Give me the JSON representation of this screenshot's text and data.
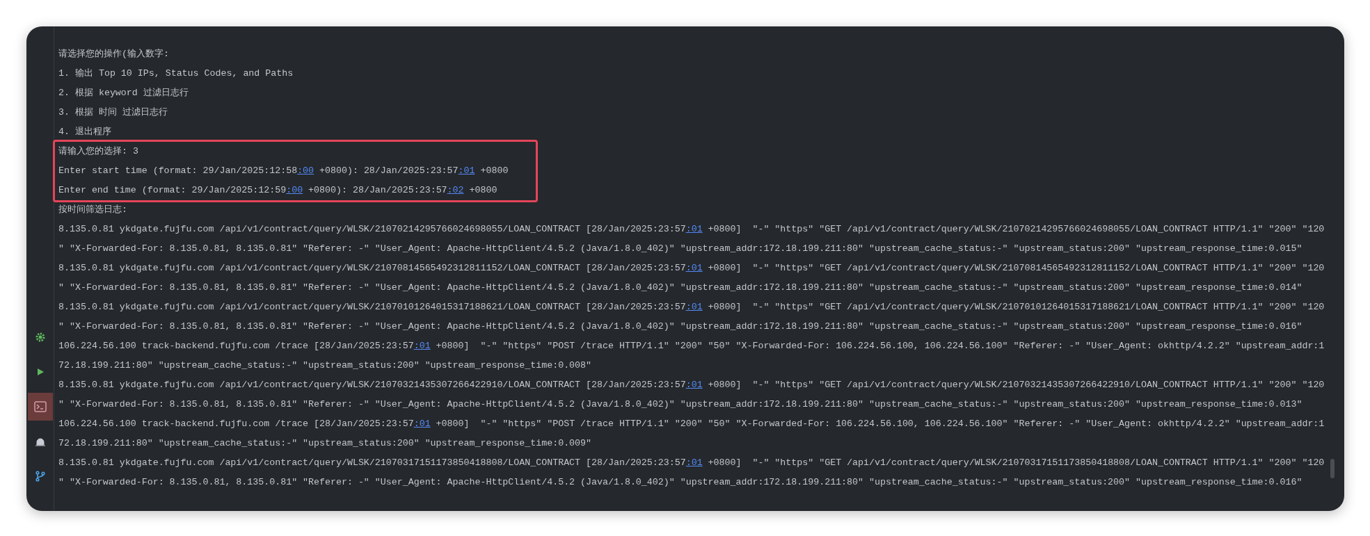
{
  "tool_strip": [
    {
      "selected": false
    },
    {
      "selected": false
    },
    {
      "selected": true
    },
    {
      "selected": false
    },
    {
      "selected": false
    }
  ],
  "console_lines": [
    {
      "highlighted": false,
      "segments": [
        {
          "kind": "plain",
          "text": "请选择您的操作(输入数字:"
        }
      ]
    },
    {
      "highlighted": false,
      "segments": [
        {
          "kind": "plain",
          "text": "1. 输出 Top 10 IPs, Status Codes, and Paths"
        }
      ]
    },
    {
      "highlighted": false,
      "segments": [
        {
          "kind": "plain",
          "text": "2. 根据 keyword 过滤日志行"
        }
      ]
    },
    {
      "highlighted": false,
      "segments": [
        {
          "kind": "plain",
          "text": "3. 根据 时间 过滤日志行"
        }
      ]
    },
    {
      "highlighted": false,
      "segments": [
        {
          "kind": "plain",
          "text": "4. 退出程序"
        }
      ]
    },
    {
      "highlighted": true,
      "segments": [
        {
          "kind": "plain",
          "text": "请输入您的选择: 3"
        }
      ]
    },
    {
      "highlighted": true,
      "segments": [
        {
          "kind": "plain",
          "text": "Enter start time (format: 29/Jan/2025:12:58"
        },
        {
          "kind": "link",
          "text": ":00"
        },
        {
          "kind": "plain",
          "text": " +0800): 28/Jan/2025:23:57"
        },
        {
          "kind": "link",
          "text": ":01"
        },
        {
          "kind": "plain",
          "text": " +0800"
        }
      ]
    },
    {
      "highlighted": true,
      "segments": [
        {
          "kind": "plain",
          "text": "Enter end time (format: 29/Jan/2025:12:59"
        },
        {
          "kind": "link",
          "text": ":00"
        },
        {
          "kind": "plain",
          "text": " +0800): 28/Jan/2025:23:57"
        },
        {
          "kind": "link",
          "text": ":02"
        },
        {
          "kind": "plain",
          "text": " +0800"
        }
      ]
    },
    {
      "highlighted": false,
      "segments": [
        {
          "kind": "plain",
          "text": "按时间筛选日志:"
        }
      ]
    },
    {
      "highlighted": false,
      "segments": [
        {
          "kind": "plain",
          "text": "8.135.0.81 ykdgate.fujfu.com /api/v1/contract/query/WLSK/21070214295766024698055/LOAN_CONTRACT [28/Jan/2025:23:57"
        },
        {
          "kind": "link",
          "text": ":01"
        },
        {
          "kind": "plain",
          "text": " +0800]  \"-\" \"https\" \"GET /api/v1/contract/query/WLSK/21070214295766024698055/LOAN_CONTRACT HTTP/1.1\" \"200\" \"120"
        }
      ]
    },
    {
      "highlighted": false,
      "segments": [
        {
          "kind": "plain",
          "text": "\" \"X-Forwarded-For: 8.135.0.81, 8.135.0.81\" \"Referer: -\" \"User_Agent: Apache-HttpClient/4.5.2 (Java/1.8.0_402)\" \"upstream_addr:172.18.199.211:80\" \"upstream_cache_status:-\" \"upstream_status:200\" \"upstream_response_time:0.015\""
        }
      ]
    },
    {
      "highlighted": false,
      "segments": [
        {
          "kind": "plain",
          "text": "8.135.0.81 ykdgate.fujfu.com /api/v1/contract/query/WLSK/21070814565492312811152/LOAN_CONTRACT [28/Jan/2025:23:57"
        },
        {
          "kind": "link",
          "text": ":01"
        },
        {
          "kind": "plain",
          "text": " +0800]  \"-\" \"https\" \"GET /api/v1/contract/query/WLSK/21070814565492312811152/LOAN_CONTRACT HTTP/1.1\" \"200\" \"120"
        }
      ]
    },
    {
      "highlighted": false,
      "segments": [
        {
          "kind": "plain",
          "text": "\" \"X-Forwarded-For: 8.135.0.81, 8.135.0.81\" \"Referer: -\" \"User_Agent: Apache-HttpClient/4.5.2 (Java/1.8.0_402)\" \"upstream_addr:172.18.199.211:80\" \"upstream_cache_status:-\" \"upstream_status:200\" \"upstream_response_time:0.014\""
        }
      ]
    },
    {
      "highlighted": false,
      "segments": [
        {
          "kind": "plain",
          "text": "8.135.0.81 ykdgate.fujfu.com /api/v1/contract/query/WLSK/21070101264015317188621/LOAN_CONTRACT [28/Jan/2025:23:57"
        },
        {
          "kind": "link",
          "text": ":01"
        },
        {
          "kind": "plain",
          "text": " +0800]  \"-\" \"https\" \"GET /api/v1/contract/query/WLSK/21070101264015317188621/LOAN_CONTRACT HTTP/1.1\" \"200\" \"120"
        }
      ]
    },
    {
      "highlighted": false,
      "segments": [
        {
          "kind": "plain",
          "text": "\" \"X-Forwarded-For: 8.135.0.81, 8.135.0.81\" \"Referer: -\" \"User_Agent: Apache-HttpClient/4.5.2 (Java/1.8.0_402)\" \"upstream_addr:172.18.199.211:80\" \"upstream_cache_status:-\" \"upstream_status:200\" \"upstream_response_time:0.016\""
        }
      ]
    },
    {
      "highlighted": false,
      "segments": [
        {
          "kind": "plain",
          "text": "106.224.56.100 track-backend.fujfu.com /trace [28/Jan/2025:23:57"
        },
        {
          "kind": "link",
          "text": ":01"
        },
        {
          "kind": "plain",
          "text": " +0800]  \"-\" \"https\" \"POST /trace HTTP/1.1\" \"200\" \"50\" \"X-Forwarded-For: 106.224.56.100, 106.224.56.100\" \"Referer: -\" \"User_Agent: okhttp/4.2.2\" \"upstream_addr:1"
        }
      ]
    },
    {
      "highlighted": false,
      "segments": [
        {
          "kind": "plain",
          "text": "72.18.199.211:80\" \"upstream_cache_status:-\" \"upstream_status:200\" \"upstream_response_time:0.008\""
        }
      ]
    },
    {
      "highlighted": false,
      "segments": [
        {
          "kind": "plain",
          "text": "8.135.0.81 ykdgate.fujfu.com /api/v1/contract/query/WLSK/21070321435307266422910/LOAN_CONTRACT [28/Jan/2025:23:57"
        },
        {
          "kind": "link",
          "text": ":01"
        },
        {
          "kind": "plain",
          "text": " +0800]  \"-\" \"https\" \"GET /api/v1/contract/query/WLSK/21070321435307266422910/LOAN_CONTRACT HTTP/1.1\" \"200\" \"120"
        }
      ]
    },
    {
      "highlighted": false,
      "segments": [
        {
          "kind": "plain",
          "text": "\" \"X-Forwarded-For: 8.135.0.81, 8.135.0.81\" \"Referer: -\" \"User_Agent: Apache-HttpClient/4.5.2 (Java/1.8.0_402)\" \"upstream_addr:172.18.199.211:80\" \"upstream_cache_status:-\" \"upstream_status:200\" \"upstream_response_time:0.013\""
        }
      ]
    },
    {
      "highlighted": false,
      "segments": [
        {
          "kind": "plain",
          "text": "106.224.56.100 track-backend.fujfu.com /trace [28/Jan/2025:23:57"
        },
        {
          "kind": "link",
          "text": ":01"
        },
        {
          "kind": "plain",
          "text": " +0800]  \"-\" \"https\" \"POST /trace HTTP/1.1\" \"200\" \"50\" \"X-Forwarded-For: 106.224.56.100, 106.224.56.100\" \"Referer: -\" \"User_Agent: okhttp/4.2.2\" \"upstream_addr:1"
        }
      ]
    },
    {
      "highlighted": false,
      "segments": [
        {
          "kind": "plain",
          "text": "72.18.199.211:80\" \"upstream_cache_status:-\" \"upstream_status:200\" \"upstream_response_time:0.009\""
        }
      ]
    },
    {
      "highlighted": false,
      "segments": [
        {
          "kind": "plain",
          "text": "8.135.0.81 ykdgate.fujfu.com /api/v1/contract/query/WLSK/21070317151173850418808/LOAN_CONTRACT [28/Jan/2025:23:57"
        },
        {
          "kind": "link",
          "text": ":01"
        },
        {
          "kind": "plain",
          "text": " +0800]  \"-\" \"https\" \"GET /api/v1/contract/query/WLSK/21070317151173850418808/LOAN_CONTRACT HTTP/1.1\" \"200\" \"120"
        }
      ]
    },
    {
      "highlighted": false,
      "segments": [
        {
          "kind": "plain",
          "text": "\" \"X-Forwarded-For: 8.135.0.81, 8.135.0.81\" \"Referer: -\" \"User_Agent: Apache-HttpClient/4.5.2 (Java/1.8.0_402)\" \"upstream_addr:172.18.199.211:80\" \"upstream_cache_status:-\" \"upstream_status:200\" \"upstream_response_time:0.016\""
        }
      ]
    }
  ]
}
